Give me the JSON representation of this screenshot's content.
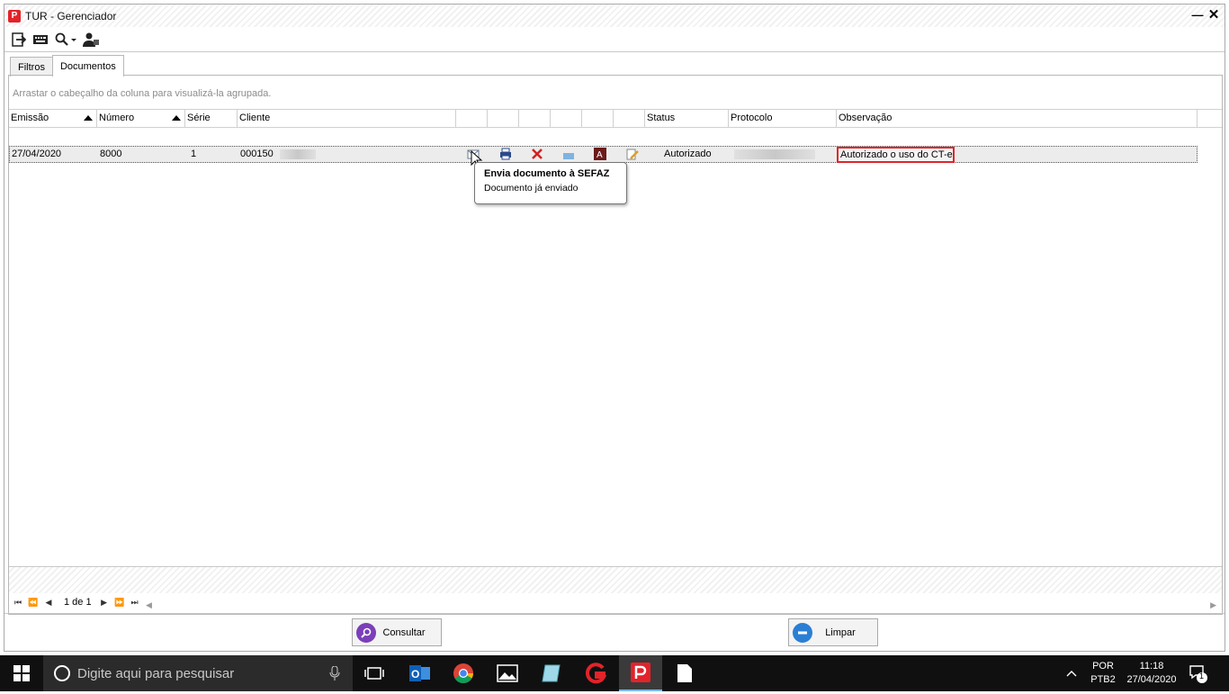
{
  "window": {
    "title": "TUR - Gerenciador",
    "app_icon_letter": "P"
  },
  "tabs": [
    {
      "label": "Filtros"
    },
    {
      "label": "Documentos"
    }
  ],
  "grid": {
    "group_hint": "Arrastar o cabeçalho da coluna para visualizá-la agrupada.",
    "columns": {
      "emissao": "Emissão",
      "numero": "Número",
      "serie": "Série",
      "cliente": "Cliente",
      "status": "Status",
      "protocolo": "Protocolo",
      "observacao": "Observação"
    },
    "row": {
      "emissao": "27/04/2020",
      "numero": "8000",
      "serie": "1",
      "cliente": "000150",
      "status": "Autorizado",
      "observacao": "Autorizado o uso do CT-e"
    }
  },
  "tooltip": {
    "title": "Envia documento à SEFAZ",
    "text": "Documento já enviado"
  },
  "pager": {
    "text": "1 de 1"
  },
  "buttons": {
    "consultar": "Consultar",
    "limpar": "Limpar"
  },
  "taskbar": {
    "search_placeholder": "Digite aqui para pesquisar",
    "lang_line1": "POR",
    "lang_line2": "PTB2",
    "time": "11:18",
    "date": "27/04/2020",
    "notification_count": "1"
  },
  "colors": {
    "brand": "#e2232a",
    "taskbar": "#101010",
    "highlight": "#e2232a"
  }
}
